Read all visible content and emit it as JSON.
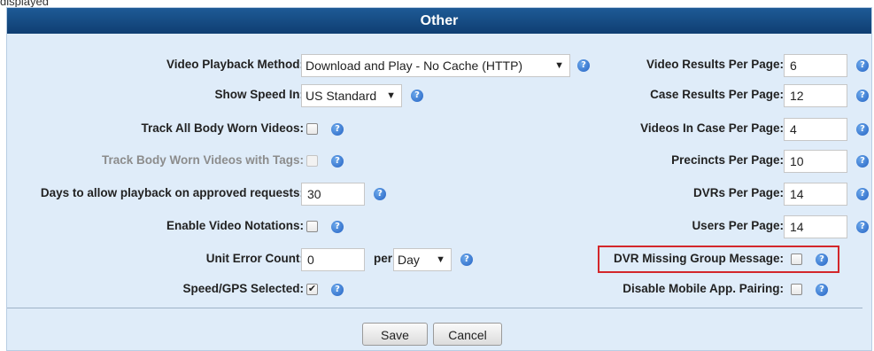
{
  "top_fragment": "displayed",
  "panel": {
    "title": "Other"
  },
  "left": {
    "video_playback_method": {
      "label": "Video Playback Method:",
      "value": "Download and Play - No Cache (HTTP)"
    },
    "show_speed_in": {
      "label": "Show Speed In:",
      "value": "US Standard"
    },
    "track_all_bwv": {
      "label": "Track All Body Worn Videos:",
      "checked": false
    },
    "track_bwv_tags": {
      "label": "Track Body Worn Videos with Tags:",
      "checked": false,
      "disabled": true
    },
    "days_playback": {
      "label": "Days to allow playback on approved requests:",
      "value": "30"
    },
    "enable_notations": {
      "label": "Enable Video Notations:",
      "checked": false
    },
    "unit_error_count": {
      "label": "Unit Error Count:",
      "value": "0",
      "per_label": "per:",
      "per_value": "Day"
    },
    "speed_gps": {
      "label": "Speed/GPS Selected:",
      "checked": true,
      "check_glyph": "✔"
    }
  },
  "right": {
    "video_results": {
      "label": "Video Results Per Page:",
      "value": "6"
    },
    "case_results": {
      "label": "Case Results Per Page:",
      "value": "12"
    },
    "videos_in_case": {
      "label": "Videos In Case Per Page:",
      "value": "4"
    },
    "precincts": {
      "label": "Precincts Per Page:",
      "value": "10"
    },
    "dvrs": {
      "label": "DVRs Per Page:",
      "value": "14"
    },
    "users": {
      "label": "Users Per Page:",
      "value": "14"
    },
    "dvr_missing_group": {
      "label": "DVR Missing Group Message:",
      "checked": false
    },
    "disable_mobile_pairing": {
      "label": "Disable Mobile App. Pairing:",
      "checked": false
    }
  },
  "buttons": {
    "save": "Save",
    "cancel": "Cancel"
  },
  "icons": {
    "help": "help-icon",
    "dropdown": "dropdown-arrow-icon"
  },
  "glyphs": {
    "help": "?",
    "arrow": "▼"
  },
  "colors": {
    "header": "#1b5591",
    "panel_bg": "#dfecf9",
    "help": "#2563c4",
    "highlight": "#d3272b"
  }
}
